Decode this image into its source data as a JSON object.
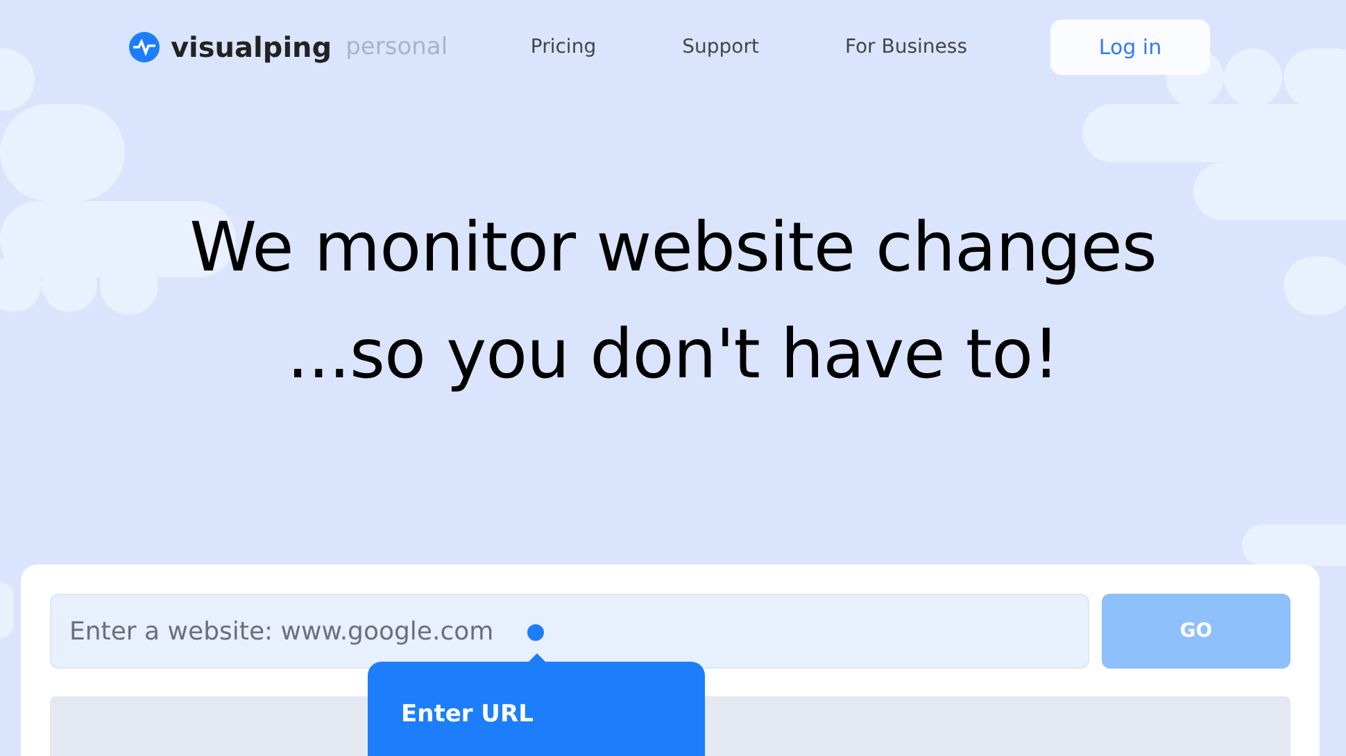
{
  "logo": {
    "name": "visualping",
    "tier": "personal"
  },
  "nav": {
    "links": [
      "Pricing",
      "Support",
      "For Business"
    ],
    "login": "Log in"
  },
  "hero": {
    "lines": [
      "We monitor website changes",
      "...so you don't have to!"
    ]
  },
  "form": {
    "placeholder": "Enter a website: www.google.com",
    "button": "GO",
    "disabled": true
  },
  "tooltip": {
    "title": "Enter URL"
  }
}
